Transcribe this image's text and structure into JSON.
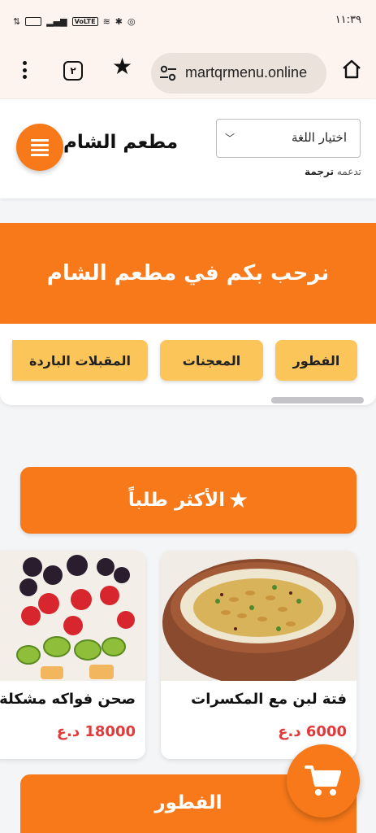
{
  "status_bar": {
    "time": "١١:٣٩",
    "network": "VoLTE"
  },
  "browser": {
    "url": "martqrmenu.online",
    "tab_count": "٢"
  },
  "header": {
    "restaurant_name": "مطعم الشام",
    "language_select": "اختيار اللغة",
    "powered_by_prefix": "تدعمه",
    "powered_by_name": "ترجمة"
  },
  "hero": {
    "title": "نرحب بكم في مطعم الشام"
  },
  "categories": [
    {
      "label": "الفطور"
    },
    {
      "label": "المعجنات"
    },
    {
      "label": "المقبلات الباردة"
    }
  ],
  "most_requested": {
    "title": "الأكثر طلباً",
    "items": [
      {
        "name": "فتة لبن مع المكسرات",
        "price": "6000 د.ع"
      },
      {
        "name": "صحن فواكه مشكلة",
        "price": "18000 د.ع"
      }
    ]
  },
  "next_section": {
    "title": "الفطور"
  },
  "colors": {
    "primary": "#f7791a",
    "category_pill": "#fcc559",
    "price": "#e03a3a"
  }
}
